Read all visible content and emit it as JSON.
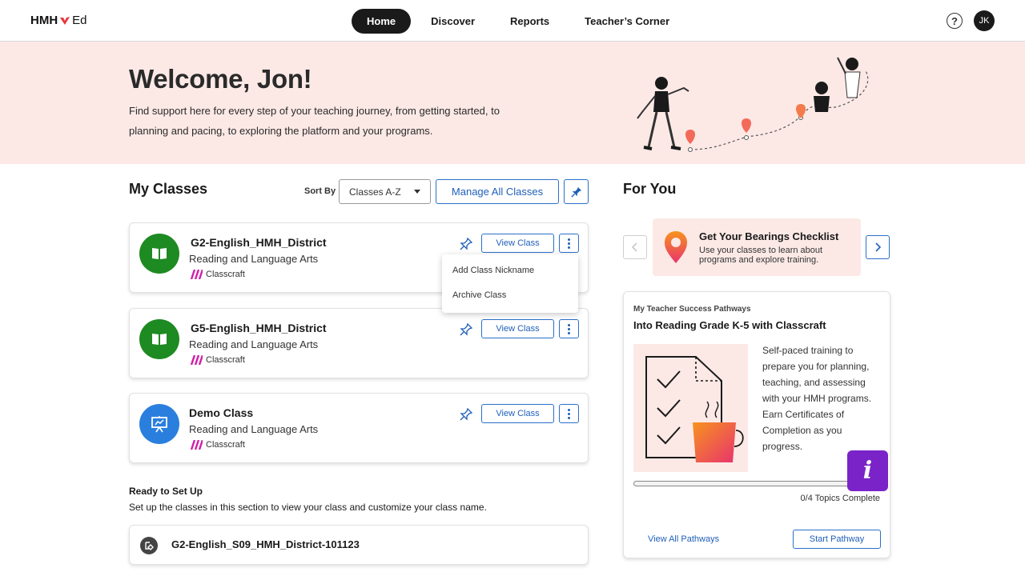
{
  "brand": {
    "logo_main": "HMH",
    "logo_ed": "Ed"
  },
  "nav": {
    "items": [
      {
        "label": "Home",
        "active": true
      },
      {
        "label": "Discover",
        "active": false
      },
      {
        "label": "Reports",
        "active": false
      },
      {
        "label": "Teacher’s Corner",
        "active": false
      }
    ],
    "help_glyph": "?",
    "avatar_initials": "JK"
  },
  "hero": {
    "title": "Welcome, Jon!",
    "description": "Find support here for every step of your teaching journey, from getting started, to planning and pacing, to exploring the platform and your programs."
  },
  "my_classes": {
    "title": "My Classes",
    "sort_label": "Sort By",
    "sort_value": "Classes A-Z",
    "manage_label": "Manage All Classes",
    "view_label": "View Class",
    "classes": [
      {
        "name": "G2-English_HMH_District",
        "subject": "Reading and Language Arts",
        "brand": "Classcraft",
        "icon": "book-icon",
        "color": "#1e8a22"
      },
      {
        "name": "G5-English_HMH_District",
        "subject": "Reading and Language Arts",
        "brand": "Classcraft",
        "icon": "book-icon",
        "color": "#1e8a22"
      },
      {
        "name": "Demo Class",
        "subject": "Reading and Language Arts",
        "brand": "Classcraft",
        "icon": "presentation-board-icon",
        "color": "#2a7fde"
      }
    ],
    "menu": {
      "items": [
        "Add Class Nickname",
        "Archive Class"
      ]
    }
  },
  "ready": {
    "title": "Ready to Set Up",
    "subtitle": "Set up the classes in this section to view your class and customize your class name.",
    "class_name": "G2-English_S09_HMH_District-101123"
  },
  "for_you": {
    "title": "For You",
    "bearings": {
      "title": "Get Your Bearings Checklist",
      "description": "Use your classes to learn about programs and explore training."
    },
    "pathway": {
      "eyebrow": "My Teacher Success Pathways",
      "title": "Into Reading Grade K-5 with Classcraft",
      "description": "Self-paced training to prepare you for planning, teaching, and assessing with your HMH programs. Earn Certificates of Completion as you progress.",
      "progress_fraction": 0,
      "progress_text": "0/4 Topics Complete",
      "view_all_label": "View All Pathways",
      "start_label": "Start Pathway"
    },
    "info_glyph": "i"
  },
  "colors": {
    "accent": "#2a6fc9",
    "hero_bg": "#fce9e6",
    "green": "#1e8a22",
    "blue": "#2a7fde",
    "purple": "#7a23c9",
    "brand_magenta": "#d11fa8"
  }
}
